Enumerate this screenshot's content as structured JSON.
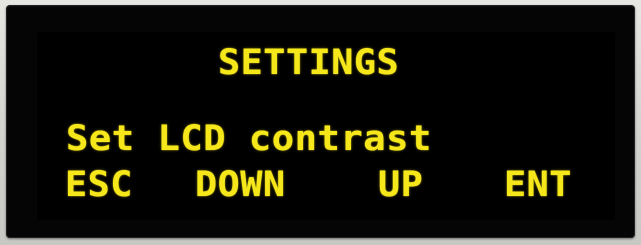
{
  "display": {
    "title": "SETTINGS",
    "message": "Set LCD contrast",
    "softkeys": {
      "esc": "ESC",
      "down": "DOWN",
      "up": "UP",
      "enter": "ENT"
    }
  },
  "colors": {
    "text": "#f6e71b",
    "screen": "#000000",
    "bezel": "#050505",
    "case": "#d7d8d4"
  }
}
